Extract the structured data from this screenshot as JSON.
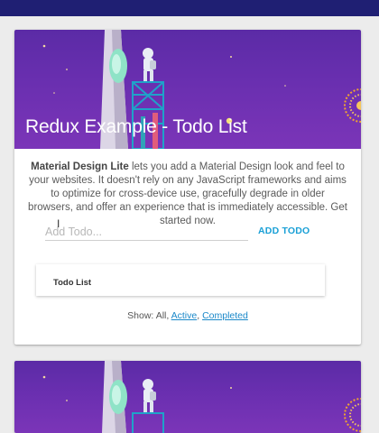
{
  "app": {
    "title": "Redux Example - Todo List"
  },
  "intro": {
    "brand": "Material Design Lite",
    "text": " lets you add a Material Design look and feel to your websites. It doesn't rely on any JavaScript frameworks and aims to optimize for cross-device use, gracefully degrade in older browsers, and offer an experience that is immediately accessible. Get started now."
  },
  "todo_input": {
    "placeholder": "Add Todo...",
    "value": ""
  },
  "add_button": {
    "label": "ADD TODO"
  },
  "todo_list": {
    "title": "Todo List",
    "items": []
  },
  "filters": {
    "prefix": "Show: ",
    "all": "All",
    "sep1": ", ",
    "active": "Active",
    "sep2": ", ",
    "completed": "Completed"
  },
  "colors": {
    "topbar": "#1f1f73",
    "hero": "#6a2fb0",
    "accent": "#1aa0d6",
    "link": "#1a88c9"
  },
  "icons": {
    "cursor": "text-cursor-icon"
  }
}
